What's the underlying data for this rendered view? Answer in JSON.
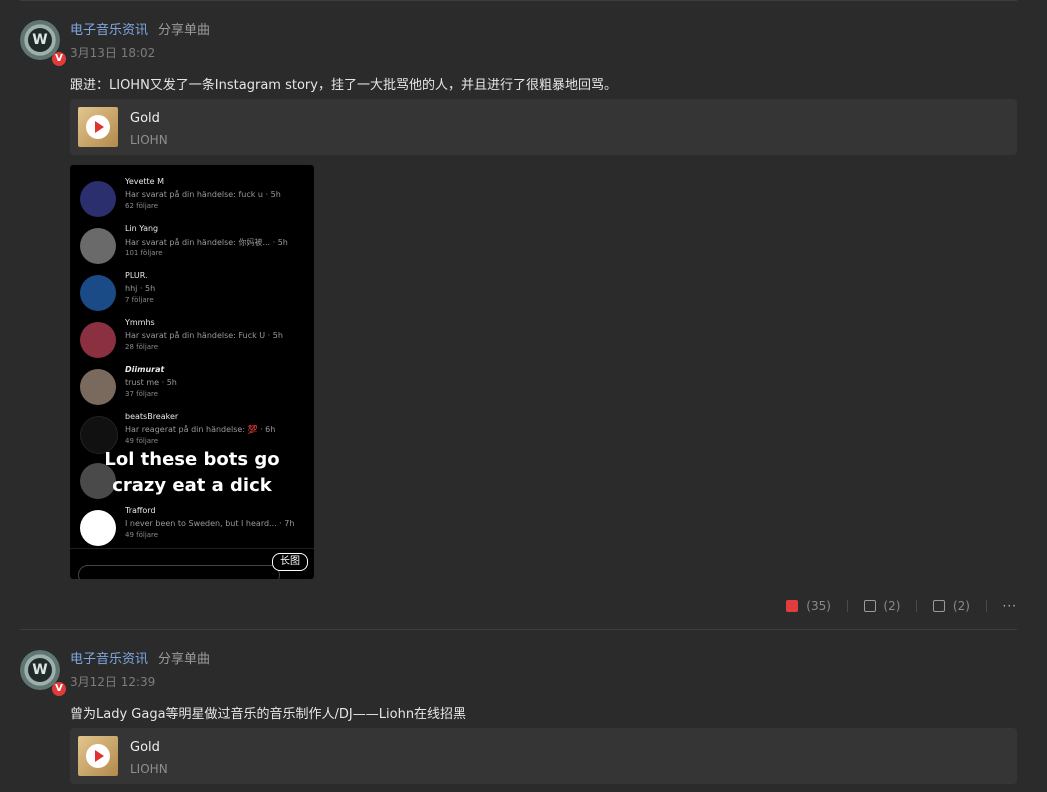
{
  "posts": [
    {
      "author": "电子音乐资讯",
      "action": "分享单曲",
      "time": "3月13日 18:02",
      "content": "跟进：LIOHN又发了一条Instagram story，挂了一大批骂他的人，并且进行了很粗暴地回骂。",
      "song": {
        "title": "Gold",
        "artist": "LIOHN"
      },
      "story": {
        "items": [
          {
            "name": "Yevette M",
            "line": "Har svarat på din händelse: fuck u · 5h",
            "followers": "62 följare"
          },
          {
            "name": "Lin Yang",
            "line": "Har svarat på din händelse: 你妈被...  · 5h",
            "followers": "101 följare"
          },
          {
            "name": "PLUR.",
            "line": "hhj · 5h",
            "followers": "7 följare"
          },
          {
            "name": "Ymmhs",
            "line": "Har svarat på din händelse: Fuck U · 5h",
            "followers": "28 följare"
          },
          {
            "name": "Diimurat",
            "line": "trust me · 5h",
            "followers": "37 följare"
          },
          {
            "name": "beatsBreaker",
            "line": "Har reagerat på din händelse: 💯 · 6h",
            "followers": "49 följare"
          },
          {
            "name": "Trafford",
            "line": "I never been to Sweden, but I heard... · 7h",
            "followers": "49 följare"
          }
        ],
        "overlay_line1": "Lol these bots go",
        "overlay_line2": "crazy eat a dick",
        "badge": "长图"
      },
      "footer": {
        "likes": "(35)",
        "shares": "(2)",
        "comments": "(2)",
        "more": "···"
      }
    },
    {
      "author": "电子音乐资讯",
      "action": "分享单曲",
      "time": "3月12日 12:39",
      "content": "曾为Lady Gaga等明星做过音乐的音乐制作人/DJ——Liohn在线招黑",
      "song": {
        "title": "Gold",
        "artist": "LIOHN"
      }
    }
  ],
  "colors": {
    "background": "#2b2b2b",
    "author": "#7ea6e0",
    "like": "#e23d3d",
    "badge_v": "#e03a3a"
  }
}
